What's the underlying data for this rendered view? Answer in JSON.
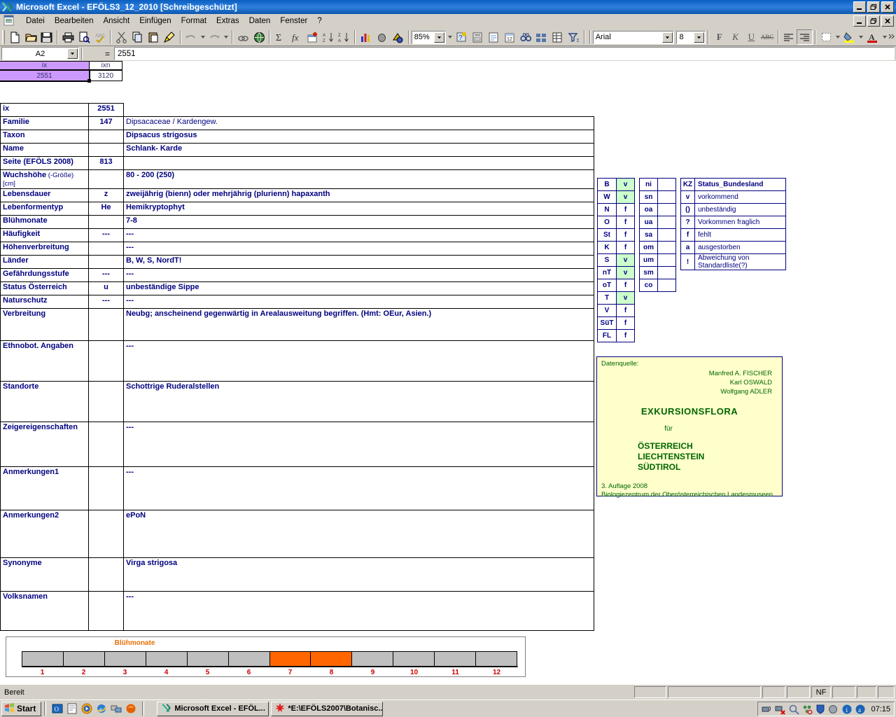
{
  "window": {
    "title": "Microsoft Excel - EFÖLS3_12_2010  [Schreibgeschützt]",
    "minimize": "_",
    "maximize": "❐",
    "close": "✕"
  },
  "menubar": {
    "items": [
      "Datei",
      "Bearbeiten",
      "Ansicht",
      "Einfügen",
      "Format",
      "Extras",
      "Daten",
      "Fenster",
      "?"
    ]
  },
  "toolbar": {
    "zoom": "85%",
    "font": "Arial",
    "font_size": "8",
    "bold_label": "F",
    "italic_label": "K",
    "underline_label": "U",
    "strike_label": "ABC",
    "icons": [
      "new-document-icon",
      "open-folder-icon",
      "save-icon",
      "print-icon",
      "print-preview-icon",
      "spellcheck-icon",
      "cut-icon",
      "copy-icon",
      "paste-icon",
      "format-painter-icon",
      "undo-icon",
      "redo-icon",
      "hyperlink-icon",
      "web-icon",
      "autosum-icon",
      "function-icon",
      "sort-icon",
      "sort-ascending-icon",
      "sort-descending-icon",
      "chart-wizard-icon",
      "drawing-icon",
      "map-icon",
      "help-icon",
      "camera-icon",
      "form-icon",
      "comment-icon",
      "find-icon",
      "window-split-icon",
      "table-icon",
      "filter-icon"
    ]
  },
  "formula_bar": {
    "name_box": "A2",
    "equals": "=",
    "content": "2551"
  },
  "top_grid": {
    "headers": [
      "ix",
      "ixn"
    ],
    "values": [
      "2551",
      "3120"
    ]
  },
  "main_table": {
    "rows": [
      {
        "label": "ix",
        "code": "",
        "value": "2551",
        "label_style": "red",
        "code_style": "",
        "value_style": "red-center"
      },
      {
        "label": "Familie",
        "code": "147",
        "value": "Dipsacaceae  /  Kardengew.",
        "value_style": "plain"
      },
      {
        "label": "Taxon",
        "code": "",
        "value": "Dipsacus strigosus",
        "value_style": "red"
      },
      {
        "label": "Name",
        "code": "",
        "value": "Schlank- Karde",
        "value_style": "redlt"
      },
      {
        "label": "Seite (EFÖLS 2008)",
        "code": "813",
        "value": ""
      },
      {
        "label": "Wuchshöhe",
        "label_suffix": " (-Größe) [cm]",
        "code": "",
        "value": "80 - 200 (250)"
      },
      {
        "label": "Lebensdauer",
        "code": "z",
        "value": "zweijährig (bienn) oder mehrjährig (plurienn) hapaxanth"
      },
      {
        "label": "Lebenformentyp",
        "code": "He",
        "value": "Hemikryptophyt"
      },
      {
        "label": "Blühmonate",
        "code": "",
        "value": "7-8"
      },
      {
        "label": "Häufigkeit",
        "code": "---",
        "value": "---"
      },
      {
        "label": "Höhenverbreitung",
        "code": "",
        "value": "---"
      },
      {
        "label": "Länder",
        "code": "",
        "value": "B, W, S, NordT!"
      },
      {
        "label": "Gefährdungsstufe",
        "code": "---",
        "value": "---"
      },
      {
        "label": "Status Österreich",
        "code": "u",
        "value": "unbeständige Sippe"
      },
      {
        "label": "Naturschutz",
        "code": "---",
        "value": "---"
      },
      {
        "label": "Verbreitung",
        "code": "",
        "value": "Neubg; anscheinend gegenwärtig in Arealausweitung begriffen. (Hmt: OEur, Asien.)",
        "tall": 46
      },
      {
        "label": "Ethnobot. Angaben",
        "code": "",
        "value": "---",
        "tall": 58
      },
      {
        "label": "Standorte",
        "code": "",
        "value": "Schottrige Ruderalstellen",
        "tall": 58
      },
      {
        "label": "Zeigereigenschaften",
        "code": "",
        "value": "---",
        "tall": 64
      },
      {
        "label": "Anmerkungen1",
        "code": "",
        "value": "---",
        "tall": 62
      },
      {
        "label": "Anmerkungen2",
        "code": "",
        "value": "ePoN",
        "tall": 68
      },
      {
        "label": "Synonyme",
        "code": "",
        "value": "Virga strigosa",
        "tall": 48
      },
      {
        "label": "Volksnamen",
        "code": "",
        "value": "---",
        "tall": 56
      }
    ]
  },
  "bundesland_table": {
    "rows": [
      {
        "code": "B",
        "status": "v",
        "present": true
      },
      {
        "code": "W",
        "status": "v",
        "present": true
      },
      {
        "code": "N",
        "status": "f",
        "present": false
      },
      {
        "code": "O",
        "status": "f",
        "present": false
      },
      {
        "code": "St",
        "status": "f",
        "present": false
      },
      {
        "code": "K",
        "status": "f",
        "present": false
      },
      {
        "code": "S",
        "status": "v",
        "present": true
      },
      {
        "code": "nT",
        "status": "v",
        "present": true
      },
      {
        "code": "oT",
        "status": "f",
        "present": false
      },
      {
        "code": "T",
        "status": "v",
        "present": true
      },
      {
        "code": "V",
        "status": "f",
        "present": false
      },
      {
        "code": "SüT",
        "status": "f",
        "present": false
      },
      {
        "code": "FL",
        "status": "f",
        "present": false
      }
    ]
  },
  "region_table": {
    "rows": [
      {
        "code": "ni",
        "status": ""
      },
      {
        "code": "sn",
        "status": ""
      },
      {
        "code": "oa",
        "status": ""
      },
      {
        "code": "ua",
        "status": ""
      },
      {
        "code": "sa",
        "status": ""
      },
      {
        "code": "om",
        "status": ""
      },
      {
        "code": "um",
        "status": ""
      },
      {
        "code": "sm",
        "status": ""
      },
      {
        "code": "co",
        "status": ""
      }
    ]
  },
  "legend_table": {
    "header": {
      "code": "KZ",
      "desc": "Status_Bundesland"
    },
    "rows": [
      {
        "code": "v",
        "desc": "vorkommend"
      },
      {
        "code": "()",
        "desc": "unbeständig"
      },
      {
        "code": "?",
        "desc": "Vorkommen fraglich"
      },
      {
        "code": "f",
        "desc": "fehlt"
      },
      {
        "code": "a",
        "desc": "ausgestorben"
      },
      {
        "code": "!",
        "desc": "Abweichung von Standardliste(?)"
      }
    ]
  },
  "source_box": {
    "label": "Datenquelle:",
    "authors": [
      "Manfred A. FISCHER",
      "Karl OSWALD",
      "Wolfgang ADLER"
    ],
    "title": "EXKURSIONSFLORA",
    "fuer": "für",
    "lands": [
      "ÖSTERREICH",
      "LIECHTENSTEIN",
      "SÜDTIROL"
    ],
    "edition": "3. Auflage 2008",
    "publisher": "Biologiezentrum der Oberösterreichischen Landesmuseen"
  },
  "chart_data": {
    "type": "bar",
    "title": "Blühmonate",
    "categories": [
      "1",
      "2",
      "3",
      "4",
      "5",
      "6",
      "7",
      "8",
      "9",
      "10",
      "11",
      "12"
    ],
    "values": [
      0,
      0,
      0,
      0,
      0,
      0,
      1,
      1,
      0,
      0,
      0,
      0
    ],
    "xlabel": "",
    "ylabel": "",
    "ylim": [
      0,
      1
    ],
    "grid": false,
    "legend": "none",
    "colors": {
      "active": "#FF6600",
      "inactive": "#BFBFBF",
      "tick_label": "#CC0000",
      "title": "#E8700A"
    },
    "annotation": "Flowering months 7 and 8 highlighted in orange"
  },
  "status_bar": {
    "message": "Bereit",
    "panes": [
      "",
      "",
      "",
      "",
      "NF",
      "",
      "",
      ""
    ]
  },
  "taskbar": {
    "start_label": "Start",
    "quick_launch": [
      "outlook-icon",
      "notepad-icon",
      "media-player-icon",
      "internet-explorer-icon",
      "network-icon",
      "firefox-icon"
    ],
    "tasks": [
      {
        "icon": "excel-icon",
        "label": "Microsoft Excel - EFÖL..."
      },
      {
        "icon": "redstar-icon",
        "label": "*E:\\EFÖLS2007\\Botanisc..."
      }
    ],
    "tray_icons": [
      "network-activity-icon",
      "network-disconnected-icon",
      "search-icon",
      "network-error-icon",
      "firewall-icon",
      "volume-icon",
      "info-icon",
      "acrobat-icon"
    ],
    "clock": "07:15"
  },
  "colors": {
    "titlebar_blue": "#0B5FC0",
    "chrome_gray": "#D4D0C8",
    "navy_text": "#000080",
    "red_text": "#CC0000",
    "lavender_cell": "#CC99FF",
    "green_cell": "#CCFFCC",
    "source_bg": "#FFFFCC",
    "source_text": "#006600",
    "orange_bar": "#FF6600"
  }
}
